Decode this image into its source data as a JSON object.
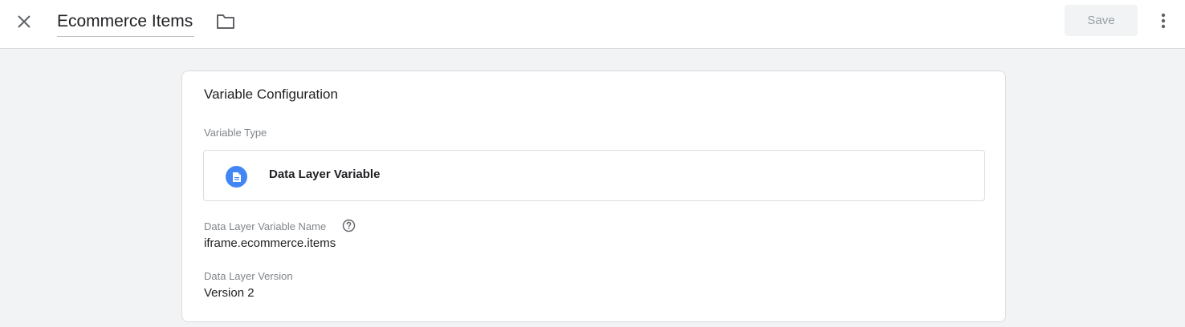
{
  "header": {
    "close_icon": "close-icon",
    "title": "Ecommerce Items",
    "folder_icon": "folder-icon",
    "save_label": "Save",
    "more_icon": "more-vert-icon"
  },
  "config": {
    "section_title": "Variable Configuration",
    "type_label": "Variable Type",
    "type_name": "Data Layer Variable",
    "type_icon": "document-icon",
    "type_icon_color": "#4285f4",
    "var_name_label": "Data Layer Variable Name",
    "help_icon": "help-icon",
    "var_name_value": "iframe.ecommerce.items",
    "version_label": "Data Layer Version",
    "version_value": "Version 2"
  }
}
